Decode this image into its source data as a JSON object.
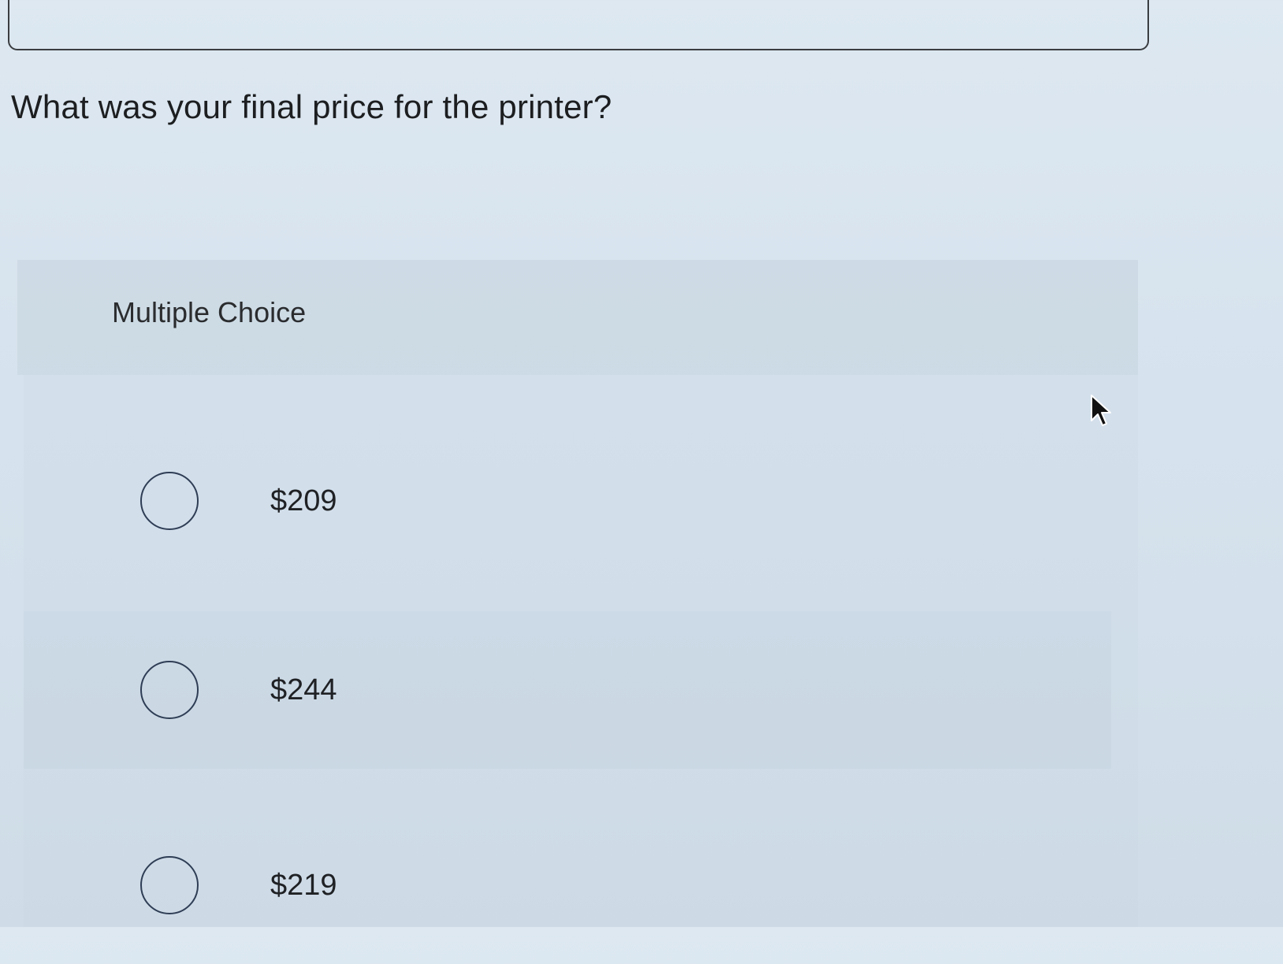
{
  "question": {
    "text": "What was your final price for the printer?"
  },
  "multiple_choice": {
    "label": "Multiple Choice",
    "options": [
      {
        "label": "$209",
        "selected": false
      },
      {
        "label": "$244",
        "selected": false
      },
      {
        "label": "$219",
        "selected": false
      }
    ]
  },
  "icons": {
    "cursor": "mouse-pointer-icon"
  },
  "colors": {
    "background": "#d7e3ee",
    "text": "#1d1f21",
    "radio_border": "#2f3d55"
  }
}
